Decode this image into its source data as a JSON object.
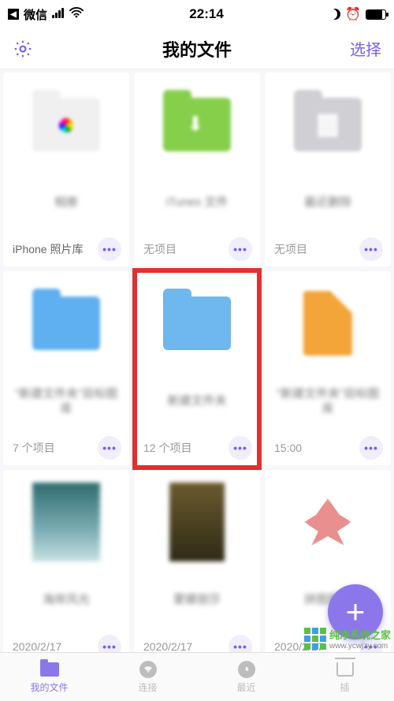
{
  "status": {
    "carrier": "微信",
    "time": "22:14"
  },
  "header": {
    "title": "我的文件",
    "select": "选择"
  },
  "items": [
    {
      "caption": "iPhone 照片库",
      "sub": "",
      "blurName": "相册"
    },
    {
      "caption": "",
      "sub": "无项目",
      "blurName": "iTunes 文件"
    },
    {
      "caption": "",
      "sub": "无项目",
      "blurName": "最近删除"
    },
    {
      "caption": "",
      "sub": "7 个项目",
      "blurName": "\"新建文件夹\"目标图库"
    },
    {
      "caption": "",
      "sub": "12 个项目",
      "blurName": "新建文件夹"
    },
    {
      "caption": "",
      "sub": "15:00",
      "blurName": "\"新建文件夹\"目标图库"
    },
    {
      "caption": "",
      "sub": "2020/2/17",
      "blurName": "海岸风光"
    },
    {
      "caption": "",
      "sub": "2020/2/17",
      "blurName": "蒙娜丽莎"
    },
    {
      "caption": "",
      "sub": "2020/2/17",
      "blurName": "拼图图标"
    }
  ],
  "tabs": {
    "files": "我的文件",
    "connect": "连接",
    "recent": "最近",
    "plugins": "插"
  },
  "watermark": {
    "line1": "纯净系统之家",
    "line2": "www.ycwjzy.com"
  }
}
